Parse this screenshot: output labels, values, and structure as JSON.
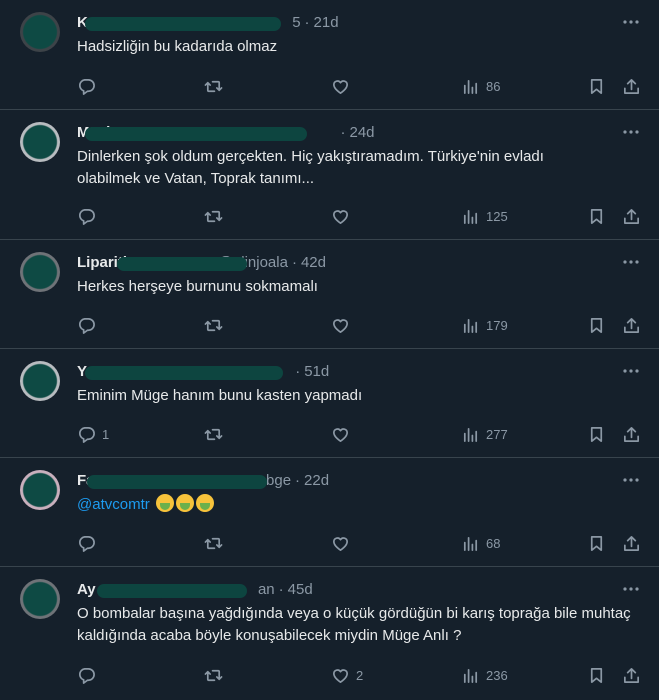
{
  "tweets": [
    {
      "name": "K",
      "handle": "5",
      "time": "21d",
      "text": "Hadsizliğin bu kadarıda olmaz",
      "replies": "",
      "likes": "",
      "views": "86",
      "avatar_style": "dark"
    },
    {
      "name": "Müzl",
      "handle": "",
      "time": "24d",
      "text": "Dinlerken şok oldum gerçekten. Hiç yakıştıramadım. Türkiye'nin evladı olabilmek ve Vatan, Toprak tanımı...",
      "replies": "",
      "likes": "",
      "views": "125",
      "avatar_style": "light"
    },
    {
      "name": "Lipariting",
      "handle": "@alinjoala",
      "time": "42d",
      "text": "Herkes herşeye burnunu sokmamalı",
      "replies": "",
      "likes": "",
      "views": "179",
      "avatar_style": "gray"
    },
    {
      "name": "Y",
      "handle": "",
      "time": "51d",
      "text": "Eminim Müge hanım bunu kasten yapmadı",
      "replies": "1",
      "likes": "",
      "views": "277",
      "avatar_style": "light"
    },
    {
      "name": "Fatı",
      "handle": "bge",
      "time": "22d",
      "text_mention": "@atvcomtr",
      "text": "",
      "replies": "",
      "likes": "",
      "views": "68",
      "avatar_style": "pink"
    },
    {
      "name": "Ay",
      "handle": "an",
      "time": "45d",
      "text": "O bombalar başına yağdığında veya o küçük gördüğün bi karış toprağa bile muhtaç kaldığında acaba böyle konuşabilecek miydin Müge Anlı ?",
      "replies": "",
      "likes": "2",
      "views": "236",
      "avatar_style": "gray"
    }
  ],
  "icons": {
    "reply": "reply-icon",
    "retweet": "retweet-icon",
    "like": "heart-icon",
    "views": "views-chart-icon",
    "bookmark": "bookmark-icon",
    "share": "share-icon",
    "more": "more-icon"
  },
  "colors": {
    "background": "#15202b",
    "divider": "#38444d",
    "text": "#e7e9ea",
    "muted": "#8b98a5",
    "link": "#1d9bf0",
    "redaction": "#0d4540"
  }
}
